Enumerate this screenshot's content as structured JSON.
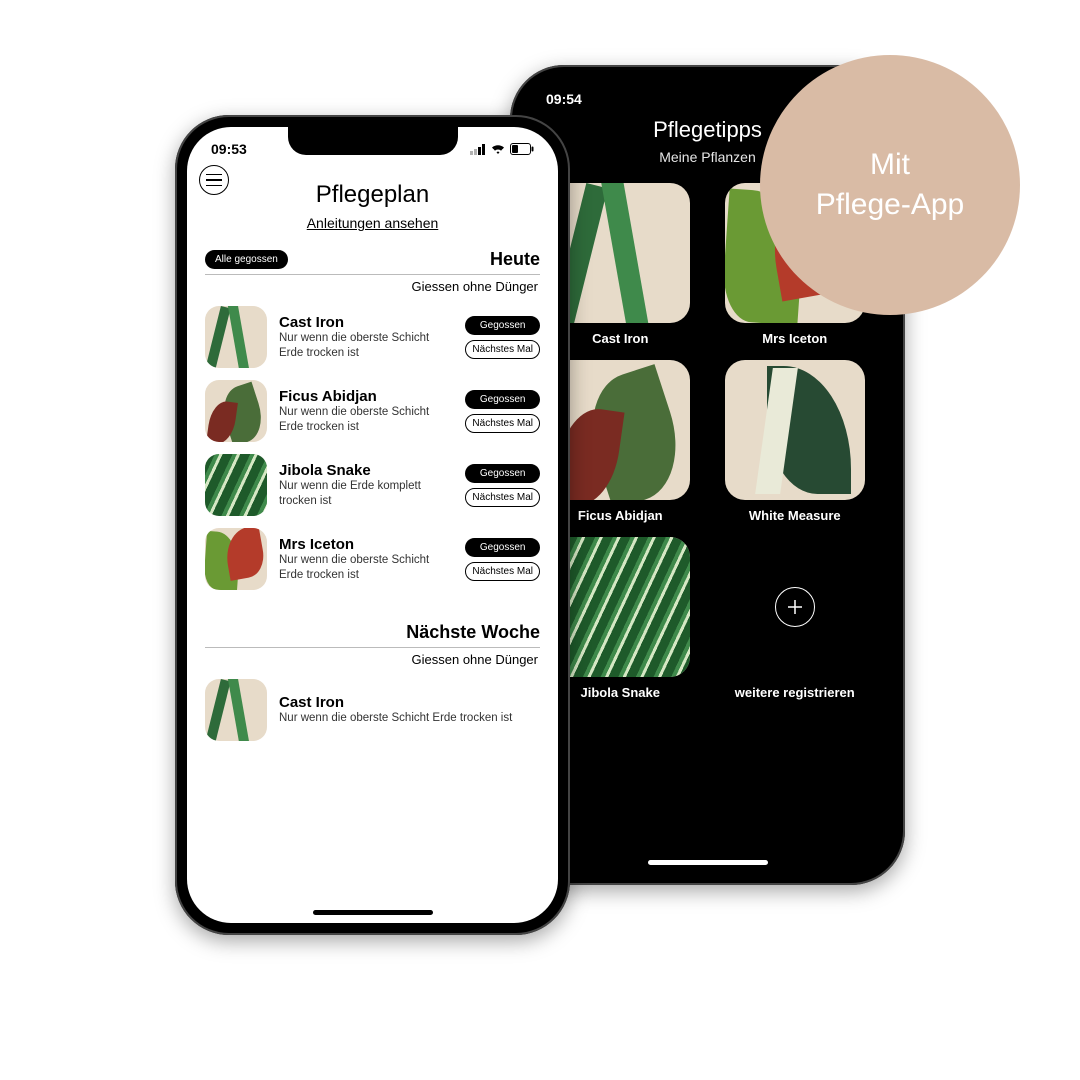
{
  "badge": {
    "line1": "Mit",
    "line2": "Pflege-App"
  },
  "leftPhone": {
    "time": "09:53",
    "title": "Pflegeplan",
    "link": "Anleitungen ansehen",
    "allWatered": "Alle gegossen",
    "today": "Heute",
    "todaySub": "Giessen ohne Dünger",
    "btnWatered": "Gegossen",
    "btnNext": "Nächstes Mal",
    "nextWeek": "Nächste Woche",
    "nextWeekSub": "Giessen ohne Dünger",
    "plants": [
      {
        "name": "Cast Iron",
        "desc": "Nur wenn die oberste Schicht Erde trocken ist"
      },
      {
        "name": "Ficus Abidjan",
        "desc": "Nur wenn die oberste Schicht Erde trocken ist"
      },
      {
        "name": "Jibola Snake",
        "desc": "Nur wenn die Erde komplett trocken ist"
      },
      {
        "name": "Mrs Iceton",
        "desc": "Nur wenn die oberste Schicht Erde trocken ist"
      }
    ],
    "nextWeekPlants": [
      {
        "name": "Cast Iron",
        "desc": "Nur wenn die oberste Schicht Erde trocken ist"
      }
    ]
  },
  "rightPhone": {
    "time": "09:54",
    "title": "Pflegetipps",
    "sub": "Meine Pflanzen",
    "tiles": [
      {
        "label": "Cast Iron"
      },
      {
        "label": "Mrs Iceton"
      },
      {
        "label": "Ficus Abidjan"
      },
      {
        "label": "White Measure"
      },
      {
        "label": "Jibola Snake"
      },
      {
        "label": "weitere registrieren"
      }
    ]
  }
}
